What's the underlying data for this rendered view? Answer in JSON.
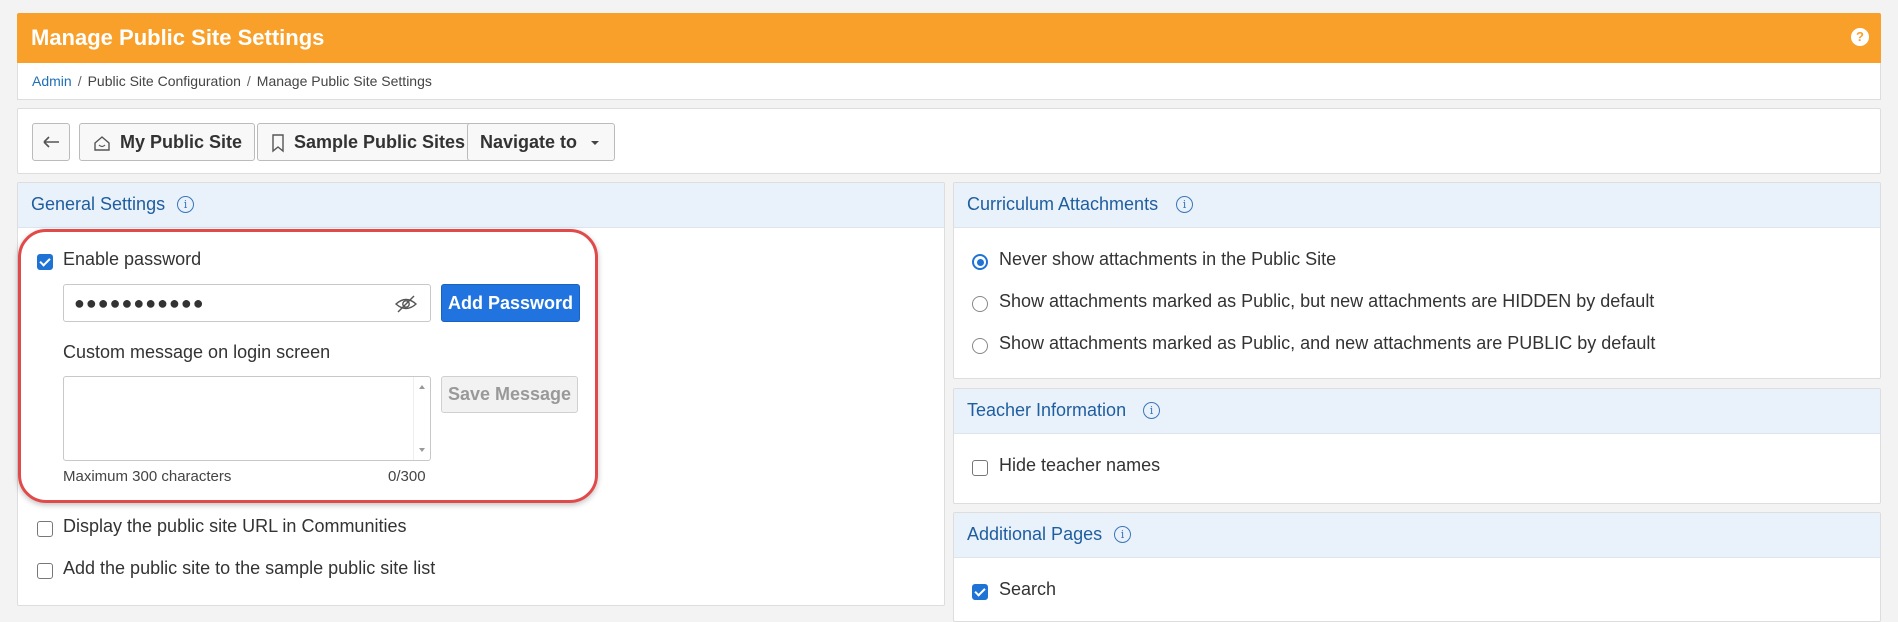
{
  "header": {
    "title": "Manage Public Site Settings",
    "help": "?"
  },
  "breadcrumb": [
    "Admin",
    "Public Site Configuration",
    "Manage Public Site Settings"
  ],
  "toolbar": {
    "back_icon": "arrow-left-icon",
    "my_public_site": "My Public Site",
    "sample_public_sites": "Sample Public Sites",
    "navigate_to": "Navigate to"
  },
  "general": {
    "title": "General Settings",
    "enable_password": "Enable password",
    "enable_password_checked": true,
    "password_value": "●●●●●●●●●●●",
    "add_password": "Add Password",
    "custom_message_label": "Custom message on login screen",
    "custom_message_value": "",
    "save_message": "Save Message",
    "max_chars": "Maximum 300 characters",
    "char_count": "0/300",
    "display_url": "Display the public site URL in Communities",
    "add_to_list": "Add the public site to the sample public site list"
  },
  "curriculum": {
    "title": "Curriculum Attachments",
    "options": [
      "Never show attachments in the Public Site",
      "Show attachments marked as Public, but new attachments are HIDDEN by default",
      "Show attachments marked as Public, and new attachments are PUBLIC by default"
    ],
    "selected_index": 0
  },
  "teacher": {
    "title": "Teacher Information",
    "hide_names": "Hide teacher names"
  },
  "additional": {
    "title": "Additional Pages",
    "search": "Search"
  },
  "colors": {
    "header": "#f9a02b",
    "accent": "#1f73d4",
    "highlight": "#e04a4a"
  }
}
